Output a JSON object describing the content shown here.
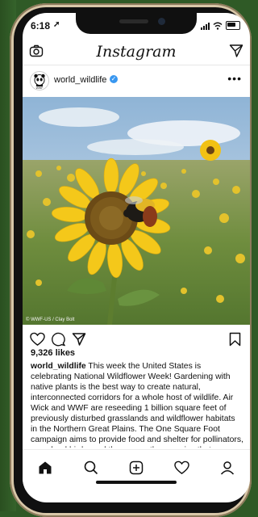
{
  "status_bar": {
    "time": "6:18"
  },
  "header": {
    "logo": "Instagram",
    "camera_icon": "camera-icon",
    "direct_icon": "paper-plane-icon"
  },
  "post": {
    "username": "world_wildlife",
    "verified_icon": "verified-badge-icon",
    "more_icon": "more-dots-icon",
    "photo_credit": "© WWF-US / Clay Bolt",
    "likes": "9,326 likes",
    "caption_username": "world_wildlife",
    "caption_text": " This week the United States is celebrating National Wildflower Week! Gardening with native plants is the best way to create natural, interconnected corridors for a whole host of wildlife. Air Wick and WWF are reseeding 1 billion square feet of previously disturbed grasslands and wildflower habitats in the Northern Great Plains. The One Square Foot campaign aims to provide food and shelter for pollinators, grassland birds, and the many other species that are native to the region. As part of this effort, we're"
  },
  "actions": {
    "like_icon": "heart-icon",
    "comment_icon": "comment-icon",
    "share_icon": "paper-plane-icon",
    "save_icon": "bookmark-icon"
  },
  "tab_bar": {
    "items": [
      "home-icon",
      "search-icon",
      "add-post-icon",
      "activity-heart-icon",
      "profile-icon"
    ]
  },
  "colors": {
    "background": "#2f5a26",
    "accent": "#3897f0",
    "frame": "#d8c7a8"
  }
}
